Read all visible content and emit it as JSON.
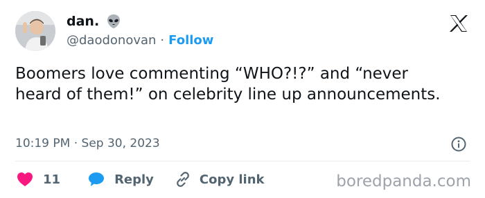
{
  "author": {
    "display_name": "dan.",
    "emoji_icon": "alien-icon",
    "handle": "@daodonovan",
    "separator": "·",
    "follow_label": "Follow"
  },
  "tweet": {
    "text": "Boomers love commenting “WHO?!?” and “never heard of them!” on celebrity line up announcements.",
    "timestamp": "10:19 PM · Sep 30, 2023"
  },
  "actions": {
    "like_count": "11",
    "reply_label": "Reply",
    "copy_link_label": "Copy link"
  },
  "watermark": "boredpanda.com",
  "colors": {
    "text": "#0f1419",
    "secondary": "#536471",
    "follow": "#1d9bf0",
    "like": "#f91880",
    "reply": "#1d9bf0"
  }
}
